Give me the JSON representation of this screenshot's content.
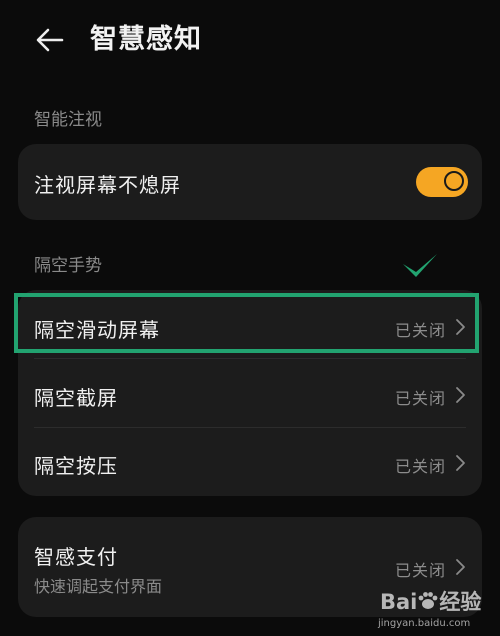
{
  "header": {
    "title": "智慧感知",
    "back_icon": "arrow-left-icon"
  },
  "sections": {
    "smart_gaze": {
      "label": "智能注视",
      "items": [
        {
          "title": "注视屏幕不熄屏",
          "toggle_on": true
        }
      ]
    },
    "air_gesture": {
      "label": "隔空手势",
      "items": [
        {
          "title": "隔空滑动屏幕",
          "status": "已关闭"
        },
        {
          "title": "隔空截屏",
          "status": "已关闭"
        },
        {
          "title": "隔空按压",
          "status": "已关闭"
        }
      ]
    },
    "payment": {
      "items": [
        {
          "title": "智感支付",
          "subtitle": "快速调起支付界面",
          "status": "已关闭"
        }
      ]
    }
  },
  "annotation": {
    "highlight_color": "#22a370",
    "check_icon": "check-mark-icon"
  },
  "watermark": {
    "logo_text_1": "Bai",
    "logo_text_2": "经验",
    "url": "jingyan.baidu.com"
  },
  "colors": {
    "background": "#0b0b0b",
    "card": "#1c1c1c",
    "toggle_on": "#f5a623"
  }
}
